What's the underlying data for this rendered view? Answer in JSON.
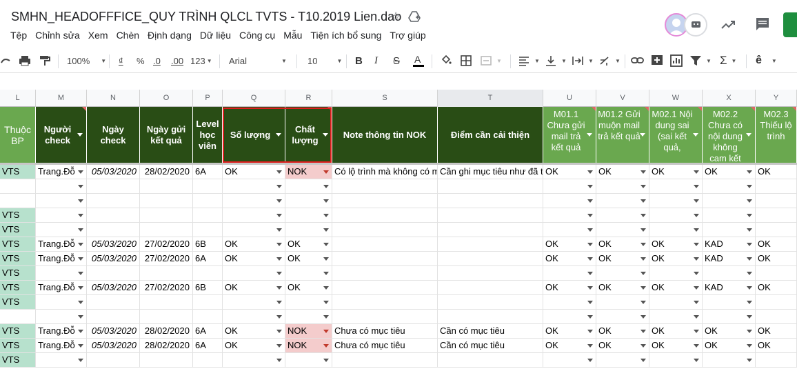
{
  "title": "SMHN_HEADOFFFICE_QUY TRÌNH QLCL TVTS - T10.2019 Lien.dao",
  "menu": [
    "Tệp",
    "Chỉnh sửa",
    "Xem",
    "Chèn",
    "Định dạng",
    "Dữ liệu",
    "Công cụ",
    "Mẫu",
    "Tiện ích bổ sung",
    "Trợ giúp"
  ],
  "toolbar": {
    "zoom": "100%",
    "currency": "₫",
    "percent": "%",
    "dec_less": ".0",
    "dec_more": ".00",
    "format_more": "123",
    "font": "Arial",
    "font_size": "10"
  },
  "columns": [
    "L",
    "M",
    "N",
    "O",
    "P",
    "Q",
    "R",
    "S",
    "T",
    "U",
    "V",
    "W",
    "X",
    "Y"
  ],
  "headers": {
    "L": "Thuộc BP",
    "M": "Người check",
    "N": "Ngày check",
    "O": "Ngày gửi kết quả",
    "P": "Level học viên",
    "Q": "Số lượng",
    "R": "Chất lượng",
    "S": "Note thông tin NOK",
    "T": "Điểm cần cải thiện",
    "U": "M01.1 Chưa gửi mail trả kết quả",
    "V": "M01.2 Gửi muộn mail trả kết quả",
    "W": "M02.1 Nội dung sai (sai kết quả,",
    "X": "M02.2 Chưa có nội dung không cam kết",
    "Y": "M02.3 Thiếu lộ trình"
  },
  "rows": [
    {
      "L": "VTS",
      "M": "Trang.Đỗ",
      "N": "05/03/2020",
      "O": "28/02/2020",
      "P": "6A",
      "Q": "OK",
      "R": "NOK",
      "S": "Có lộ trình mà không có mục tiêu",
      "T": "Cần ghi mục tiêu như đã t",
      "U": "OK",
      "V": "OK",
      "W": "OK",
      "X": "OK",
      "Y": "OK"
    },
    {
      "L": "",
      "M": "",
      "N": "",
      "O": "",
      "P": "",
      "Q": "",
      "R": "",
      "S": "",
      "T": "",
      "U": "",
      "V": "",
      "W": "",
      "X": "",
      "Y": ""
    },
    {
      "L": "",
      "M": "",
      "N": "",
      "O": "",
      "P": "",
      "Q": "",
      "R": "",
      "S": "",
      "T": "",
      "U": "",
      "V": "",
      "W": "",
      "X": "",
      "Y": ""
    },
    {
      "L": "VTS",
      "M": "",
      "N": "",
      "O": "",
      "P": "",
      "Q": "",
      "R": "",
      "S": "",
      "T": "",
      "U": "",
      "V": "",
      "W": "",
      "X": "",
      "Y": ""
    },
    {
      "L": "VTS",
      "M": "",
      "N": "",
      "O": "",
      "P": "",
      "Q": "",
      "R": "",
      "S": "",
      "T": "",
      "U": "",
      "V": "",
      "W": "",
      "X": "",
      "Y": ""
    },
    {
      "L": "VTS",
      "M": "Trang.Đỗ",
      "N": "05/03/2020",
      "O": "27/02/2020",
      "P": "6B",
      "Q": "OK",
      "R": "OK",
      "S": "",
      "T": "",
      "U": "OK",
      "V": "OK",
      "W": "OK",
      "X": "KAD",
      "Y": "OK"
    },
    {
      "L": "VTS",
      "M": "Trang.Đỗ",
      "N": "05/03/2020",
      "O": "27/02/2020",
      "P": "6A",
      "Q": "OK",
      "R": "OK",
      "S": "",
      "T": "",
      "U": "OK",
      "V": "OK",
      "W": "OK",
      "X": "KAD",
      "Y": "OK"
    },
    {
      "L": "VTS",
      "M": "",
      "N": "",
      "O": "",
      "P": "",
      "Q": "",
      "R": "",
      "S": "",
      "T": "",
      "U": "",
      "V": "",
      "W": "",
      "X": "",
      "Y": ""
    },
    {
      "L": "VTS",
      "M": "Trang.Đỗ",
      "N": "05/03/2020",
      "O": "27/02/2020",
      "P": "6B",
      "Q": "OK",
      "R": "OK",
      "S": "",
      "T": "",
      "U": "OK",
      "V": "OK",
      "W": "OK",
      "X": "KAD",
      "Y": "OK"
    },
    {
      "L": "VTS",
      "M": "",
      "N": "",
      "O": "",
      "P": "",
      "Q": "",
      "R": "",
      "S": "",
      "T": "",
      "U": "",
      "V": "",
      "W": "",
      "X": "",
      "Y": ""
    },
    {
      "L": "",
      "M": "",
      "N": "",
      "O": "",
      "P": "",
      "Q": "",
      "R": "",
      "S": "",
      "T": "",
      "U": "",
      "V": "",
      "W": "",
      "X": "",
      "Y": ""
    },
    {
      "L": "VTS",
      "M": "Trang.Đỗ",
      "N": "05/03/2020",
      "O": "28/02/2020",
      "P": "6A",
      "Q": "OK",
      "R": "NOK",
      "S": "Chưa có mục tiêu",
      "T": "Cần có mục tiêu",
      "U": "OK",
      "V": "OK",
      "W": "OK",
      "X": "OK",
      "Y": "OK"
    },
    {
      "L": "VTS",
      "M": "Trang.Đỗ",
      "N": "05/03/2020",
      "O": "28/02/2020",
      "P": "6A",
      "Q": "OK",
      "R": "NOK",
      "S": "Chưa có mục tiêu",
      "T": "Cần có mục tiêu",
      "U": "OK",
      "V": "OK",
      "W": "OK",
      "X": "OK",
      "Y": "OK"
    },
    {
      "L": "VTS",
      "M": "",
      "N": "",
      "O": "",
      "P": "",
      "Q": "",
      "R": "",
      "S": "",
      "T": "",
      "U": "",
      "V": "",
      "W": "",
      "X": "",
      "Y": ""
    }
  ],
  "colors": {
    "header_dark": "#294d15",
    "header_mid": "#376521",
    "header_light": "#6aa84f",
    "bp_fill": "#b7e1cd",
    "nok_fill": "#f4cccc",
    "highlight_border": "#e01e1e"
  }
}
